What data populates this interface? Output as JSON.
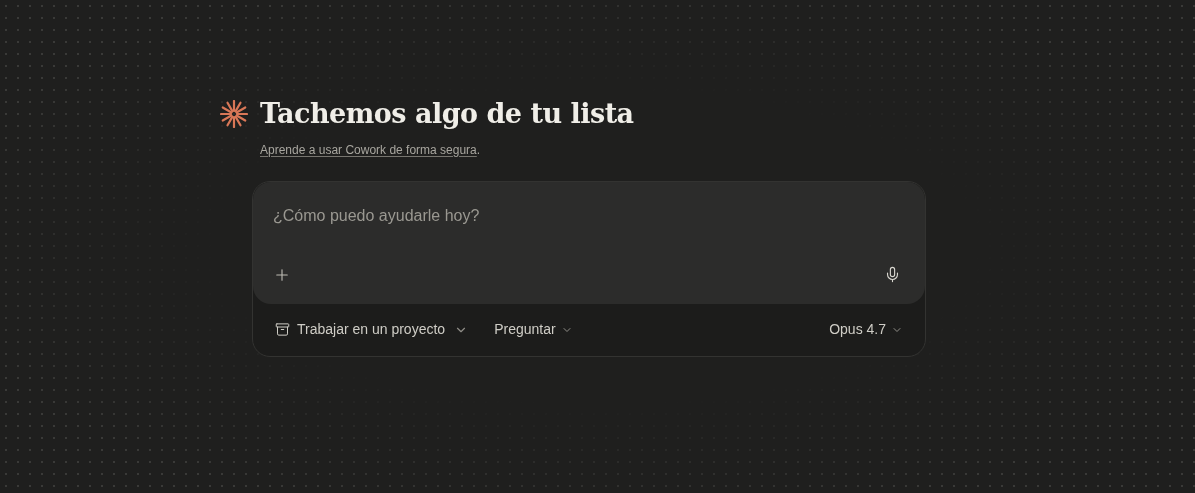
{
  "heading": "Tachemos algo de tu lista",
  "subtitle": {
    "link": "Aprende a usar Cowork de forma segura",
    "after": "."
  },
  "composer": {
    "placeholder": "¿Cómo puedo ayudarle hoy?"
  },
  "toolbar": {
    "project": "Trabajar en un proyecto",
    "mode": "Preguntar",
    "model": "Opus 4.7"
  }
}
